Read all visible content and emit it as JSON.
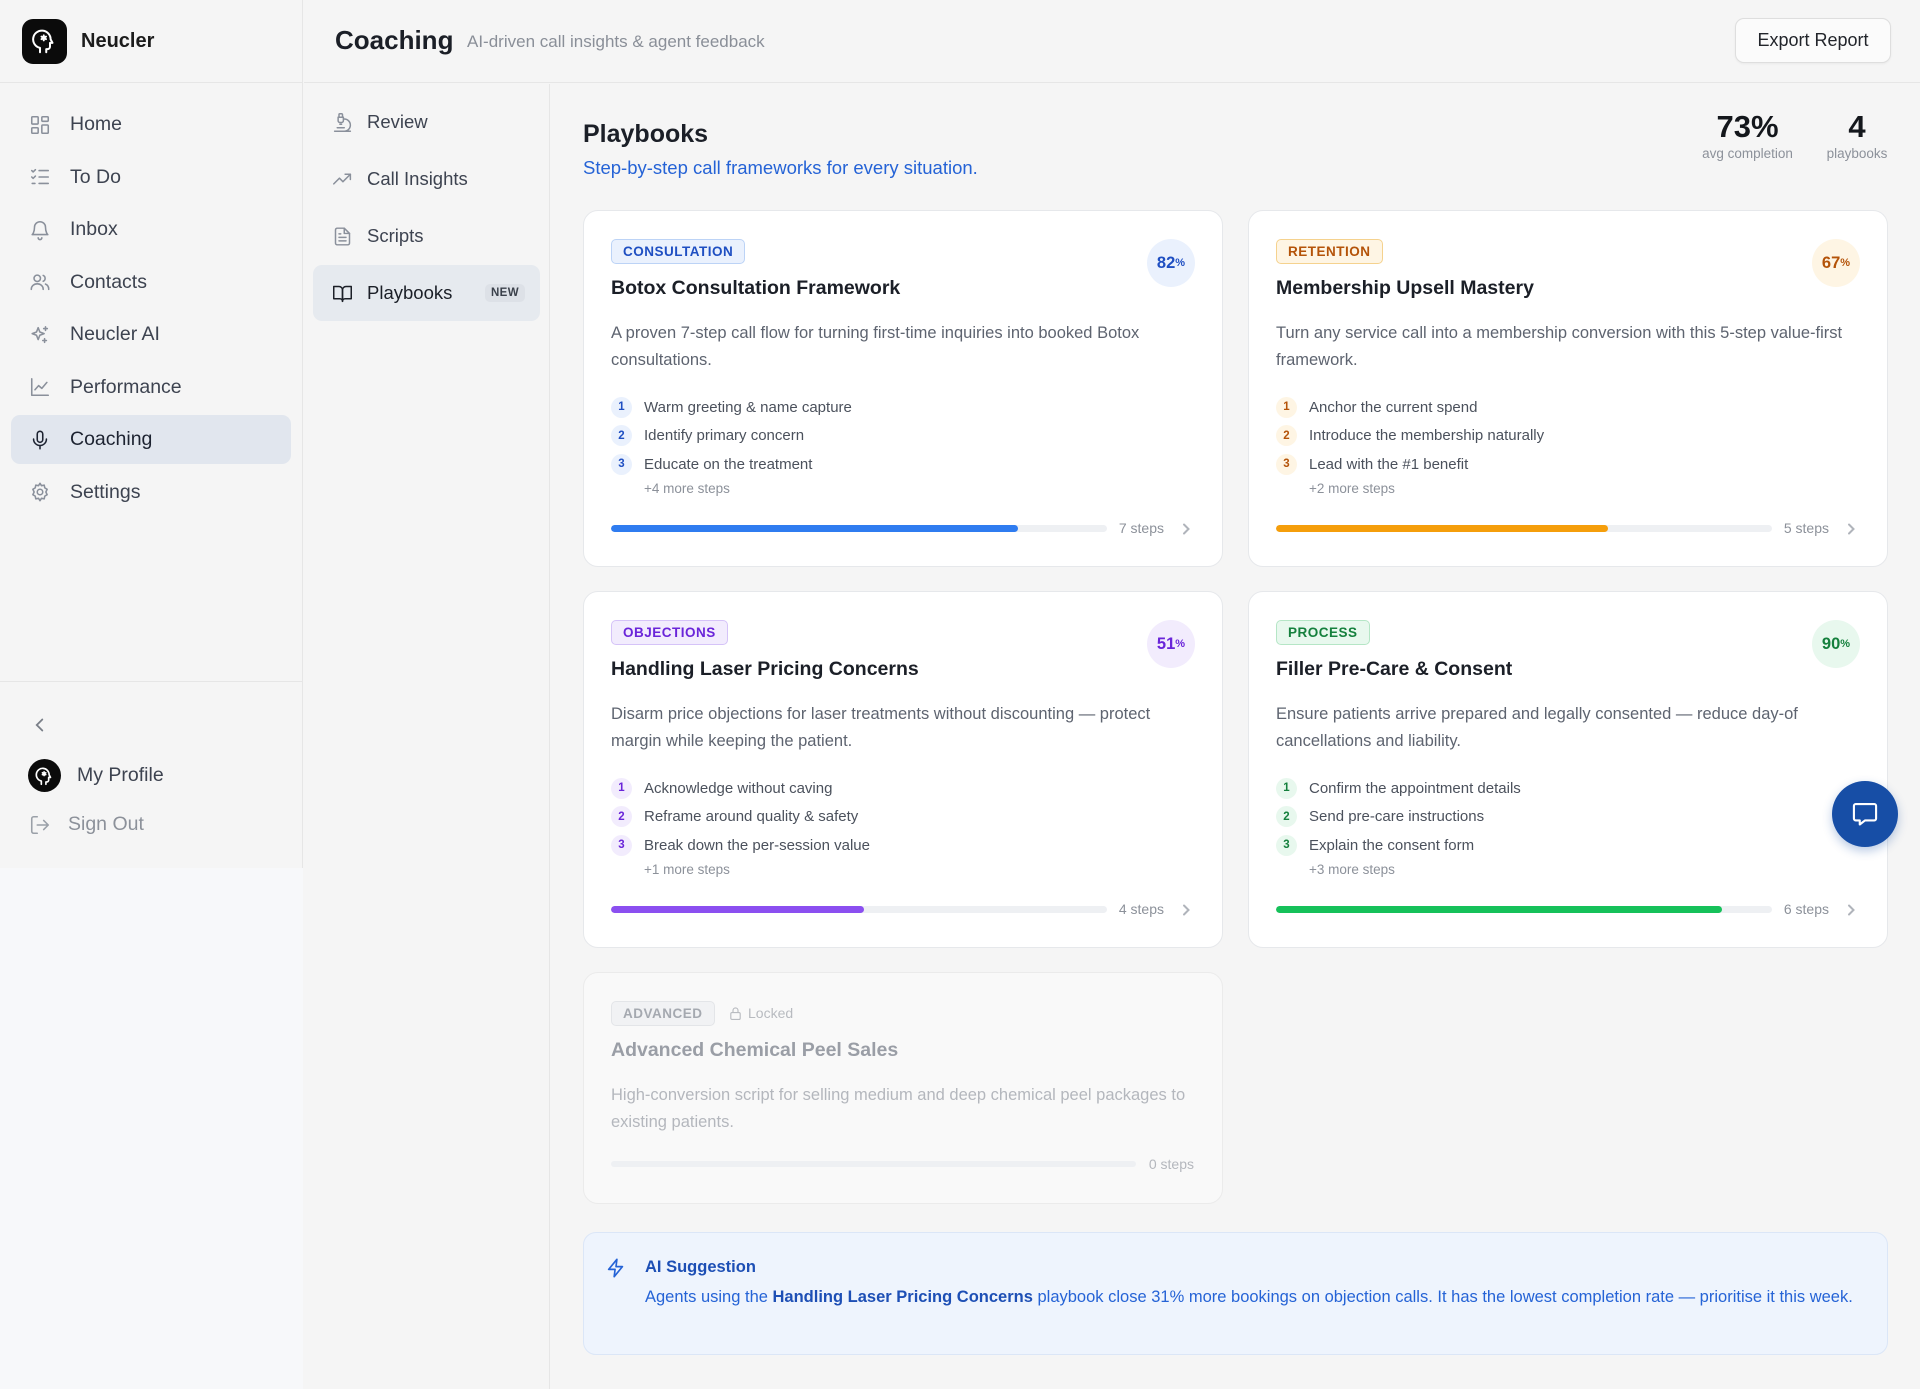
{
  "app": {
    "name": "Neucler"
  },
  "sidebar": {
    "items": [
      {
        "label": "Home",
        "icon": "grid-icon"
      },
      {
        "label": "To Do",
        "icon": "checklist-icon"
      },
      {
        "label": "Inbox",
        "icon": "bell-icon"
      },
      {
        "label": "Contacts",
        "icon": "users-icon"
      },
      {
        "label": "Neucler AI",
        "icon": "sparkles-icon"
      },
      {
        "label": "Performance",
        "icon": "chart-line-icon"
      },
      {
        "label": "Coaching",
        "icon": "microphone-icon",
        "active": true
      },
      {
        "label": "Settings",
        "icon": "gear-icon"
      }
    ],
    "profile_label": "My Profile",
    "signout_label": "Sign Out"
  },
  "header": {
    "title": "Coaching",
    "subtitle": "AI-driven call insights & agent feedback",
    "export_label": "Export Report"
  },
  "subnav": {
    "items": [
      {
        "label": "Review",
        "icon": "microscope-icon"
      },
      {
        "label": "Call Insights",
        "icon": "trend-up-icon"
      },
      {
        "label": "Scripts",
        "icon": "document-icon"
      },
      {
        "label": "Playbooks",
        "icon": "book-open-icon",
        "active": true,
        "badge": "NEW"
      }
    ]
  },
  "main": {
    "title": "Playbooks",
    "subtitle": "Step-by-step call frameworks for every situation.",
    "stats": [
      {
        "value": "73%",
        "label": "avg completion"
      },
      {
        "value": "4",
        "label": "playbooks"
      }
    ],
    "cards": [
      {
        "tag": "CONSULTATION",
        "title": "Botox Consultation Framework",
        "description": "A proven 7-step call flow for turning first-time inquiries into booked Botox consultations.",
        "completion": 82,
        "percent_suffix": "%",
        "steps": [
          "Warm greeting & name capture",
          "Identify primary concern",
          "Educate on the treatment"
        ],
        "more": "+4 more steps",
        "step_count": "7 steps",
        "accent": "#2f7cf0",
        "accent_text": "#1f4fc2",
        "accent_bg": "#eaf1fd",
        "tag_border": "#bcd3f6"
      },
      {
        "tag": "RETENTION",
        "title": "Membership Upsell Mastery",
        "description": "Turn any service call into a membership conversion with this 5-step value-first framework.",
        "completion": 67,
        "percent_suffix": "%",
        "steps": [
          "Anchor the current spend",
          "Introduce the membership naturally",
          "Lead with the #1 benefit"
        ],
        "more": "+2 more steps",
        "step_count": "5 steps",
        "accent": "#f59e0b",
        "accent_text": "#b45309",
        "accent_bg": "#fef5e4",
        "tag_border": "#f5d28e"
      },
      {
        "tag": "OBJECTIONS",
        "title": "Handling Laser Pricing Concerns",
        "description": "Disarm price objections for laser treatments without discounting — protect margin while keeping the patient.",
        "completion": 51,
        "percent_suffix": "%",
        "steps": [
          "Acknowledge without caving",
          "Reframe around quality & safety",
          "Break down the per-session value"
        ],
        "more": "+1 more steps",
        "step_count": "4 steps",
        "accent": "#8b4ff0",
        "accent_text": "#6a25d9",
        "accent_bg": "#f2ecfd",
        "tag_border": "#d5c3f8"
      },
      {
        "tag": "PROCESS",
        "title": "Filler Pre-Care & Consent",
        "description": "Ensure patients arrive prepared and legally consented — reduce day-of cancellations and liability.",
        "completion": 90,
        "percent_suffix": "%",
        "steps": [
          "Confirm the appointment details",
          "Send pre-care instructions",
          "Explain the consent form"
        ],
        "more": "+3 more steps",
        "step_count": "6 steps",
        "accent": "#16c15a",
        "accent_text": "#15803d",
        "accent_bg": "#e8f8ee",
        "tag_border": "#b5e6c6"
      }
    ],
    "locked_card": {
      "tag": "ADVANCED",
      "locked_label": "Locked",
      "title": "Advanced Chemical Peel Sales",
      "description": "High-conversion script for selling medium and deep chemical peel packages to existing patients.",
      "step_count": "0 steps"
    },
    "ai": {
      "title": "AI Suggestion",
      "text_before": "Agents using the ",
      "highlight": "Handling Laser Pricing Concerns",
      "text_after": " playbook close 31% more bookings on objection calls. It has the lowest completion rate — prioritise it this week."
    }
  }
}
